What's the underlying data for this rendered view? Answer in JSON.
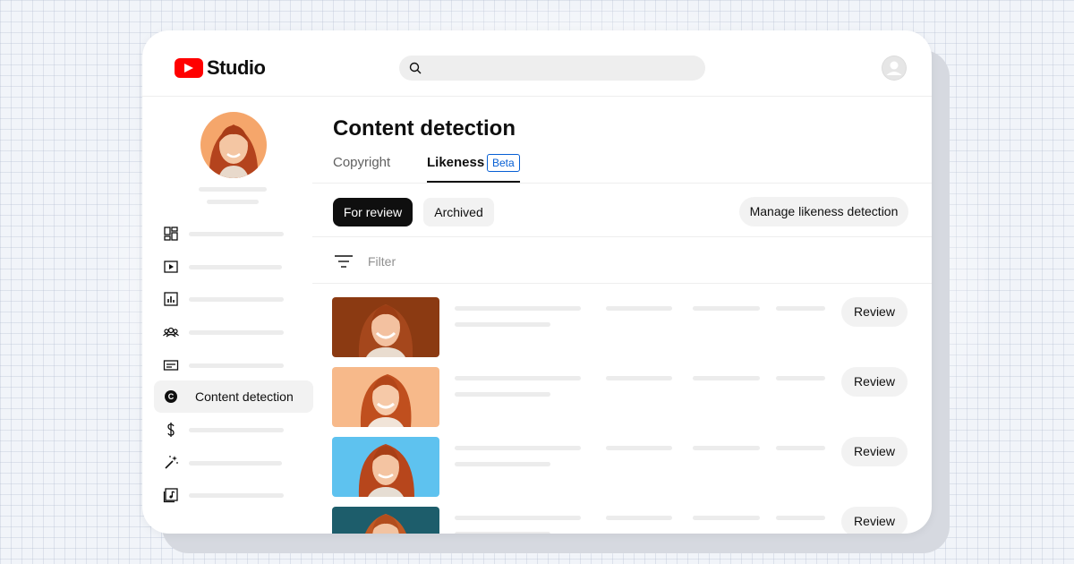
{
  "header": {
    "logo_text": "Studio",
    "logo_icon": "youtube-play-icon",
    "search_icon": "search-icon",
    "account_icon": "account-icon"
  },
  "sidebar": {
    "items": [
      {
        "icon": "dashboard-icon",
        "label": ""
      },
      {
        "icon": "content-icon",
        "label": ""
      },
      {
        "icon": "analytics-icon",
        "label": ""
      },
      {
        "icon": "community-icon",
        "label": ""
      },
      {
        "icon": "subtitles-icon",
        "label": ""
      },
      {
        "icon": "copyright-c-icon",
        "label": "Content detection",
        "active": true
      },
      {
        "icon": "earn-dollar-icon",
        "label": ""
      },
      {
        "icon": "customization-wand-icon",
        "label": ""
      },
      {
        "icon": "audio-library-icon",
        "label": ""
      }
    ]
  },
  "main": {
    "title": "Content detection",
    "tabs": [
      {
        "label": "Copyright",
        "active": false
      },
      {
        "label": "Likeness",
        "active": true,
        "badge": "Beta"
      }
    ],
    "chips": [
      {
        "label": "For review",
        "active": true
      },
      {
        "label": "Archived",
        "active": false
      }
    ],
    "manage_button": "Manage likeness detection",
    "filter_label": "Filter",
    "rows": [
      {
        "thumb_bg": "#8b3a12",
        "action": "Review"
      },
      {
        "thumb_bg": "#f7b98a",
        "action": "Review"
      },
      {
        "thumb_bg": "#5ec2ef",
        "action": "Review"
      },
      {
        "thumb_bg": "#1d5d6b",
        "action": "Review"
      }
    ]
  },
  "colors": {
    "brand_red": "#ff0000",
    "beta_blue": "#065fd4",
    "text_primary": "#0f0f0f"
  }
}
